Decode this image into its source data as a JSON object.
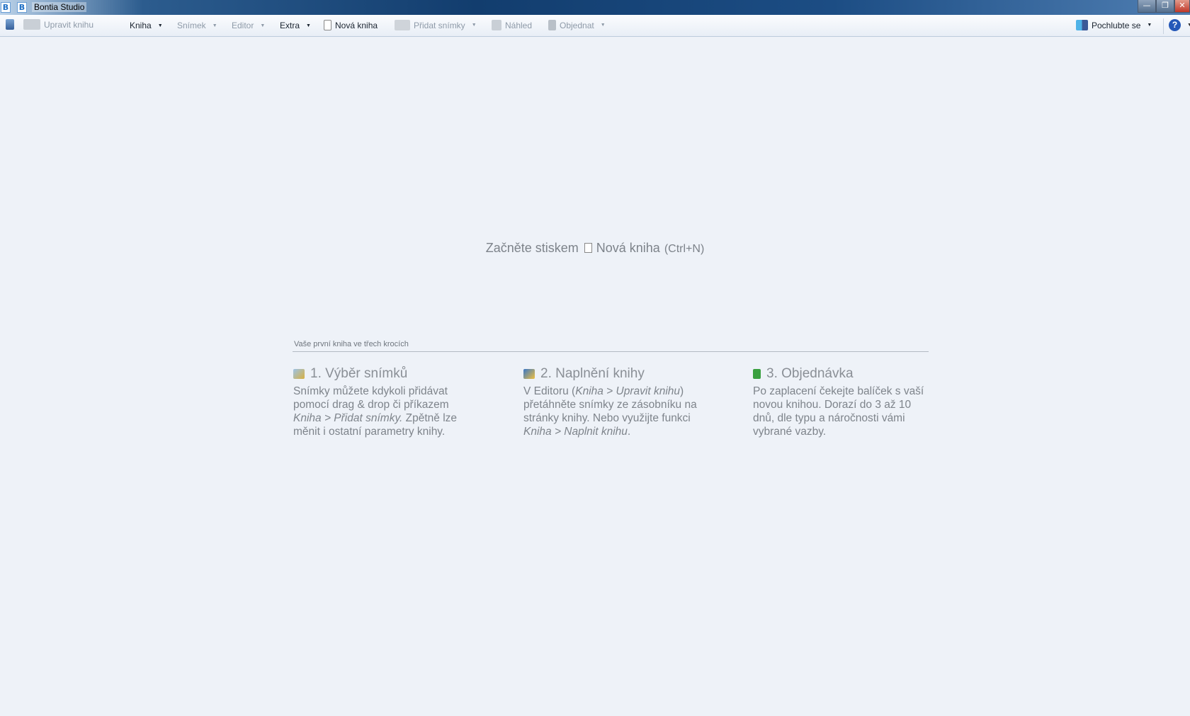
{
  "window": {
    "title": "Bontia Studio",
    "app_icon": "B",
    "controls": {
      "minimize": "—",
      "maximize": "❐",
      "close": "✕"
    }
  },
  "toolbar": {
    "upravit": "Upravit knihu",
    "kniha": "Kniha",
    "snimek": "Snímek",
    "editor": "Editor",
    "extra": "Extra",
    "nova": "Nová kniha",
    "pridat": "Přidat snímky",
    "nahled": "Náhled",
    "objednat": "Objednat",
    "pochlubte": "Pochlubte se",
    "help": "?"
  },
  "start": {
    "prefix": "Začněte stiskem",
    "action": "Nová kniha",
    "shortcut": "(Ctrl+N)"
  },
  "steps_header": "Vaše první kniha ve třech krocích",
  "steps": [
    {
      "title": "1. Výběr snímků",
      "t1": "Snímky můžete kdykoli přidávat pomocí drag & drop či příkazem ",
      "i1": "Kniha > Přidat snímky.",
      "t2": " Zpětně lze měnit i ostatní parametry knihy."
    },
    {
      "title": "2. Naplnění knihy",
      "t1": "V Editoru (",
      "i1": "Kniha > Upravit knihu",
      "t2": ") přetáhněte snímky ze zásobníku na stránky knihy. Nebo využijte funkci ",
      "i2": "Kniha > Naplnit knihu",
      "t3": "."
    },
    {
      "title": "3. Objednávka",
      "t1": "Po zaplacení čekejte balíček s vaší novou knihou. Dorazí do 3 až 10 dnů, dle typu a náročnosti vámi vybrané vazby."
    }
  ]
}
